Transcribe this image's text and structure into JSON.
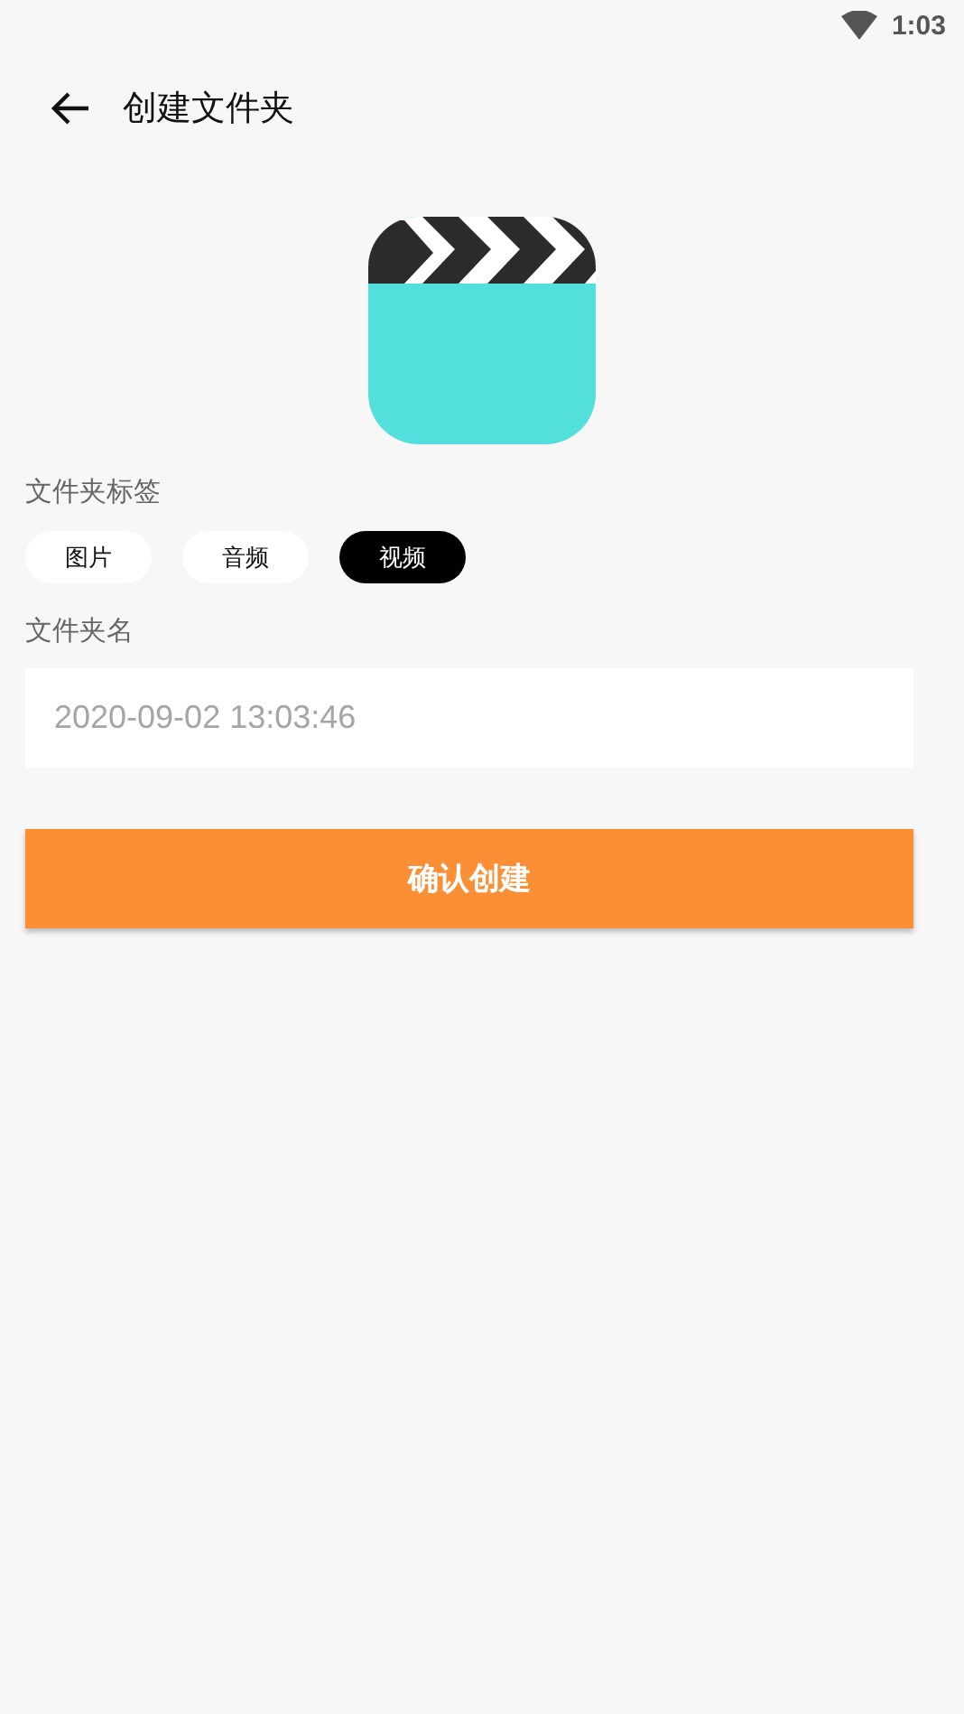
{
  "status_bar": {
    "time": "1:03"
  },
  "header": {
    "title": "创建文件夹"
  },
  "tags": {
    "label": "文件夹标签",
    "items": [
      {
        "label": "图片",
        "selected": false
      },
      {
        "label": "音频",
        "selected": false
      },
      {
        "label": "视频",
        "selected": true
      }
    ]
  },
  "name_field": {
    "label": "文件夹名",
    "placeholder": "2020-09-02 13:03:46"
  },
  "confirm_button": "确认创建"
}
